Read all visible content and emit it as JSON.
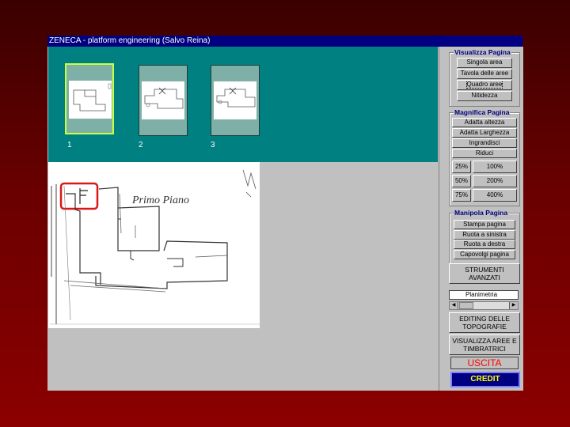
{
  "window": {
    "title": "ZENECA - platform engineering (Salvo Reina)"
  },
  "thumbnails": [
    {
      "label": "1",
      "selected": true
    },
    {
      "label": "2",
      "selected": false
    },
    {
      "label": "3",
      "selected": false
    }
  ],
  "preview": {
    "sketch_text": "Primo Piano"
  },
  "groups": {
    "visualizza": {
      "title": "Visualizza Pagina",
      "buttons": [
        "Singola area",
        "Tavola delle aree",
        "Quadro aree",
        "Nitidezza"
      ]
    },
    "magnifica": {
      "title": "Magnifica Pagina",
      "buttons": [
        "Adatta altezza",
        "Adatta Larghezza",
        "Ingrandisci",
        "Riduci"
      ],
      "zoom": [
        "25%",
        "100%",
        "50%",
        "200%",
        "75%",
        "400%"
      ]
    },
    "manipola": {
      "title": "Manipola Pagina",
      "buttons": [
        "Stampa pagina",
        "Ruota a sinistra",
        "Ruota a destra",
        "Capovolgi pagina"
      ]
    }
  },
  "tools": {
    "strumenti": "STRUMENTI AVANZATI",
    "layer_select": "Planimetria",
    "editing": "EDITING DELLE TOPOGRAFIE",
    "visualizza_aree": "VISUALIZZA AREE E TIMBRATRICI",
    "uscita": "USCITA",
    "credit": "CREDIT"
  },
  "colors": {
    "titlebar": "#000080",
    "thumb_panel": "#008080",
    "selected_border": "#c8ff40",
    "highlight_box": "#d81818",
    "uscita_text": "#ff0000",
    "credit_text": "#ffff00"
  }
}
